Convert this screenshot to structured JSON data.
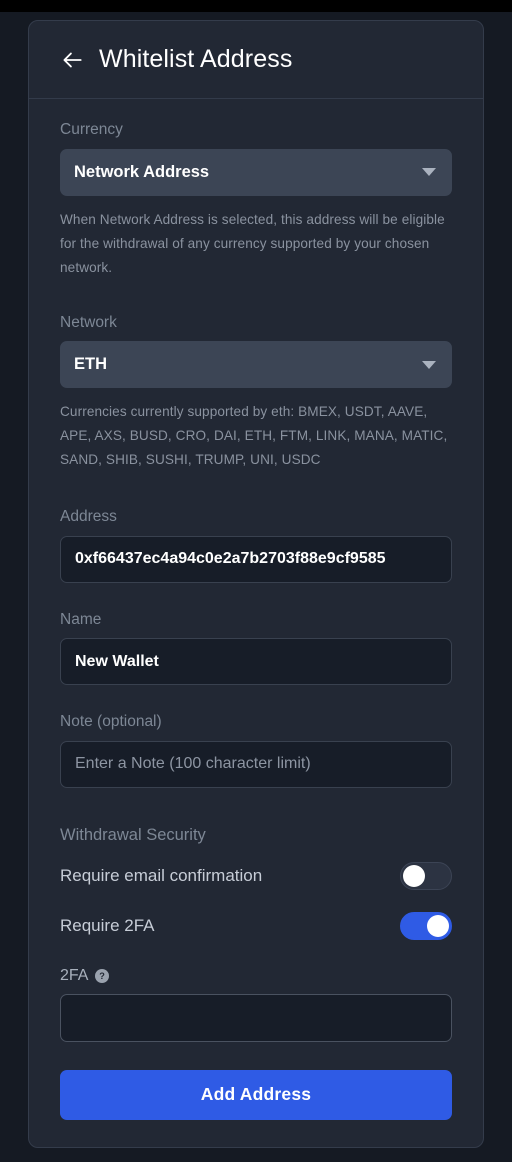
{
  "header": {
    "back_icon": "arrow-left-icon",
    "title": "Whitelist Address"
  },
  "form": {
    "currency": {
      "label": "Currency",
      "selected": "Network Address",
      "helper": "When Network Address is selected, this address will be eligible for the withdrawal of any currency supported by your chosen network."
    },
    "network": {
      "label": "Network",
      "selected": "ETH",
      "helper": "Currencies currently supported by eth: BMEX, USDT, AAVE, APE, AXS, BUSD, CRO, DAI, ETH, FTM, LINK, MANA, MATIC, SAND, SHIB, SUSHI, TRUMP, UNI, USDC"
    },
    "address": {
      "label": "Address",
      "value": "0xf66437ec4a94c0e2a7b2703f88e9cf9585"
    },
    "name": {
      "label": "Name",
      "value": "New Wallet"
    },
    "note": {
      "label": "Note (optional)",
      "value": "",
      "placeholder": "Enter a Note (100 character limit)"
    }
  },
  "security": {
    "section_title": "Withdrawal Security",
    "email_confirmation": {
      "label": "Require email confirmation",
      "enabled": false
    },
    "require_2fa": {
      "label": "Require 2FA",
      "enabled": true
    },
    "twofa_field": {
      "label": "2FA",
      "help_icon": "question-mark-circle-icon",
      "value": "",
      "placeholder": ""
    }
  },
  "actions": {
    "submit_label": "Add Address"
  },
  "colors": {
    "accent_blue": "#2f5be5",
    "page_background": "#151a23",
    "card_background": "#222834",
    "select_background": "#3c4555",
    "input_background": "#171d28",
    "label_grey": "#7d8795"
  }
}
